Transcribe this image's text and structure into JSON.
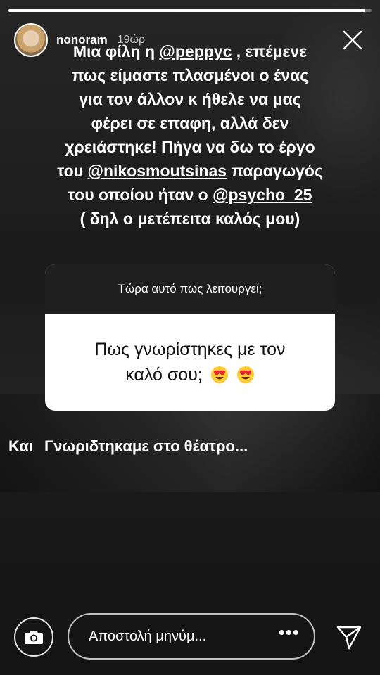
{
  "story": {
    "progress": 0.98,
    "username": "nonoram",
    "time": "19ώρ",
    "text_lines": [
      [
        "Μια φίλη η ",
        "@peppyc",
        " , επέμενε"
      ],
      [
        "πως είμαστε πλασμένοι ο ένας"
      ],
      [
        "για τον άλλον κ ήθελε να μας"
      ],
      [
        "φέρει σε επαφη, αλλά δεν"
      ],
      [
        "χρειάστηκε! Πήγα να δω το έργο"
      ],
      [
        "του ",
        "@nikosmoutsinas",
        " παραγωγός"
      ],
      [
        "του οποίου ήταν ο ",
        "@psycho_25"
      ],
      [
        "( δηλ ο μετέπειτα καλός μου)"
      ]
    ]
  },
  "question": {
    "title": "Τώρα αυτό πως λειτουργεί;",
    "line1": "Πως γνωρίστηκες με τον",
    "line2": "καλό σου;"
  },
  "answer": {
    "part1": "Και",
    "part2": "Γνωριδτηκαμε στο θέατρο..."
  },
  "reply": {
    "placeholder": "Αποστολή μηνύμ...",
    "more": "•••"
  },
  "icons": {
    "close": "close-icon",
    "camera": "camera-icon",
    "send": "send-icon",
    "emoji": "heart-eyes-emoji"
  }
}
